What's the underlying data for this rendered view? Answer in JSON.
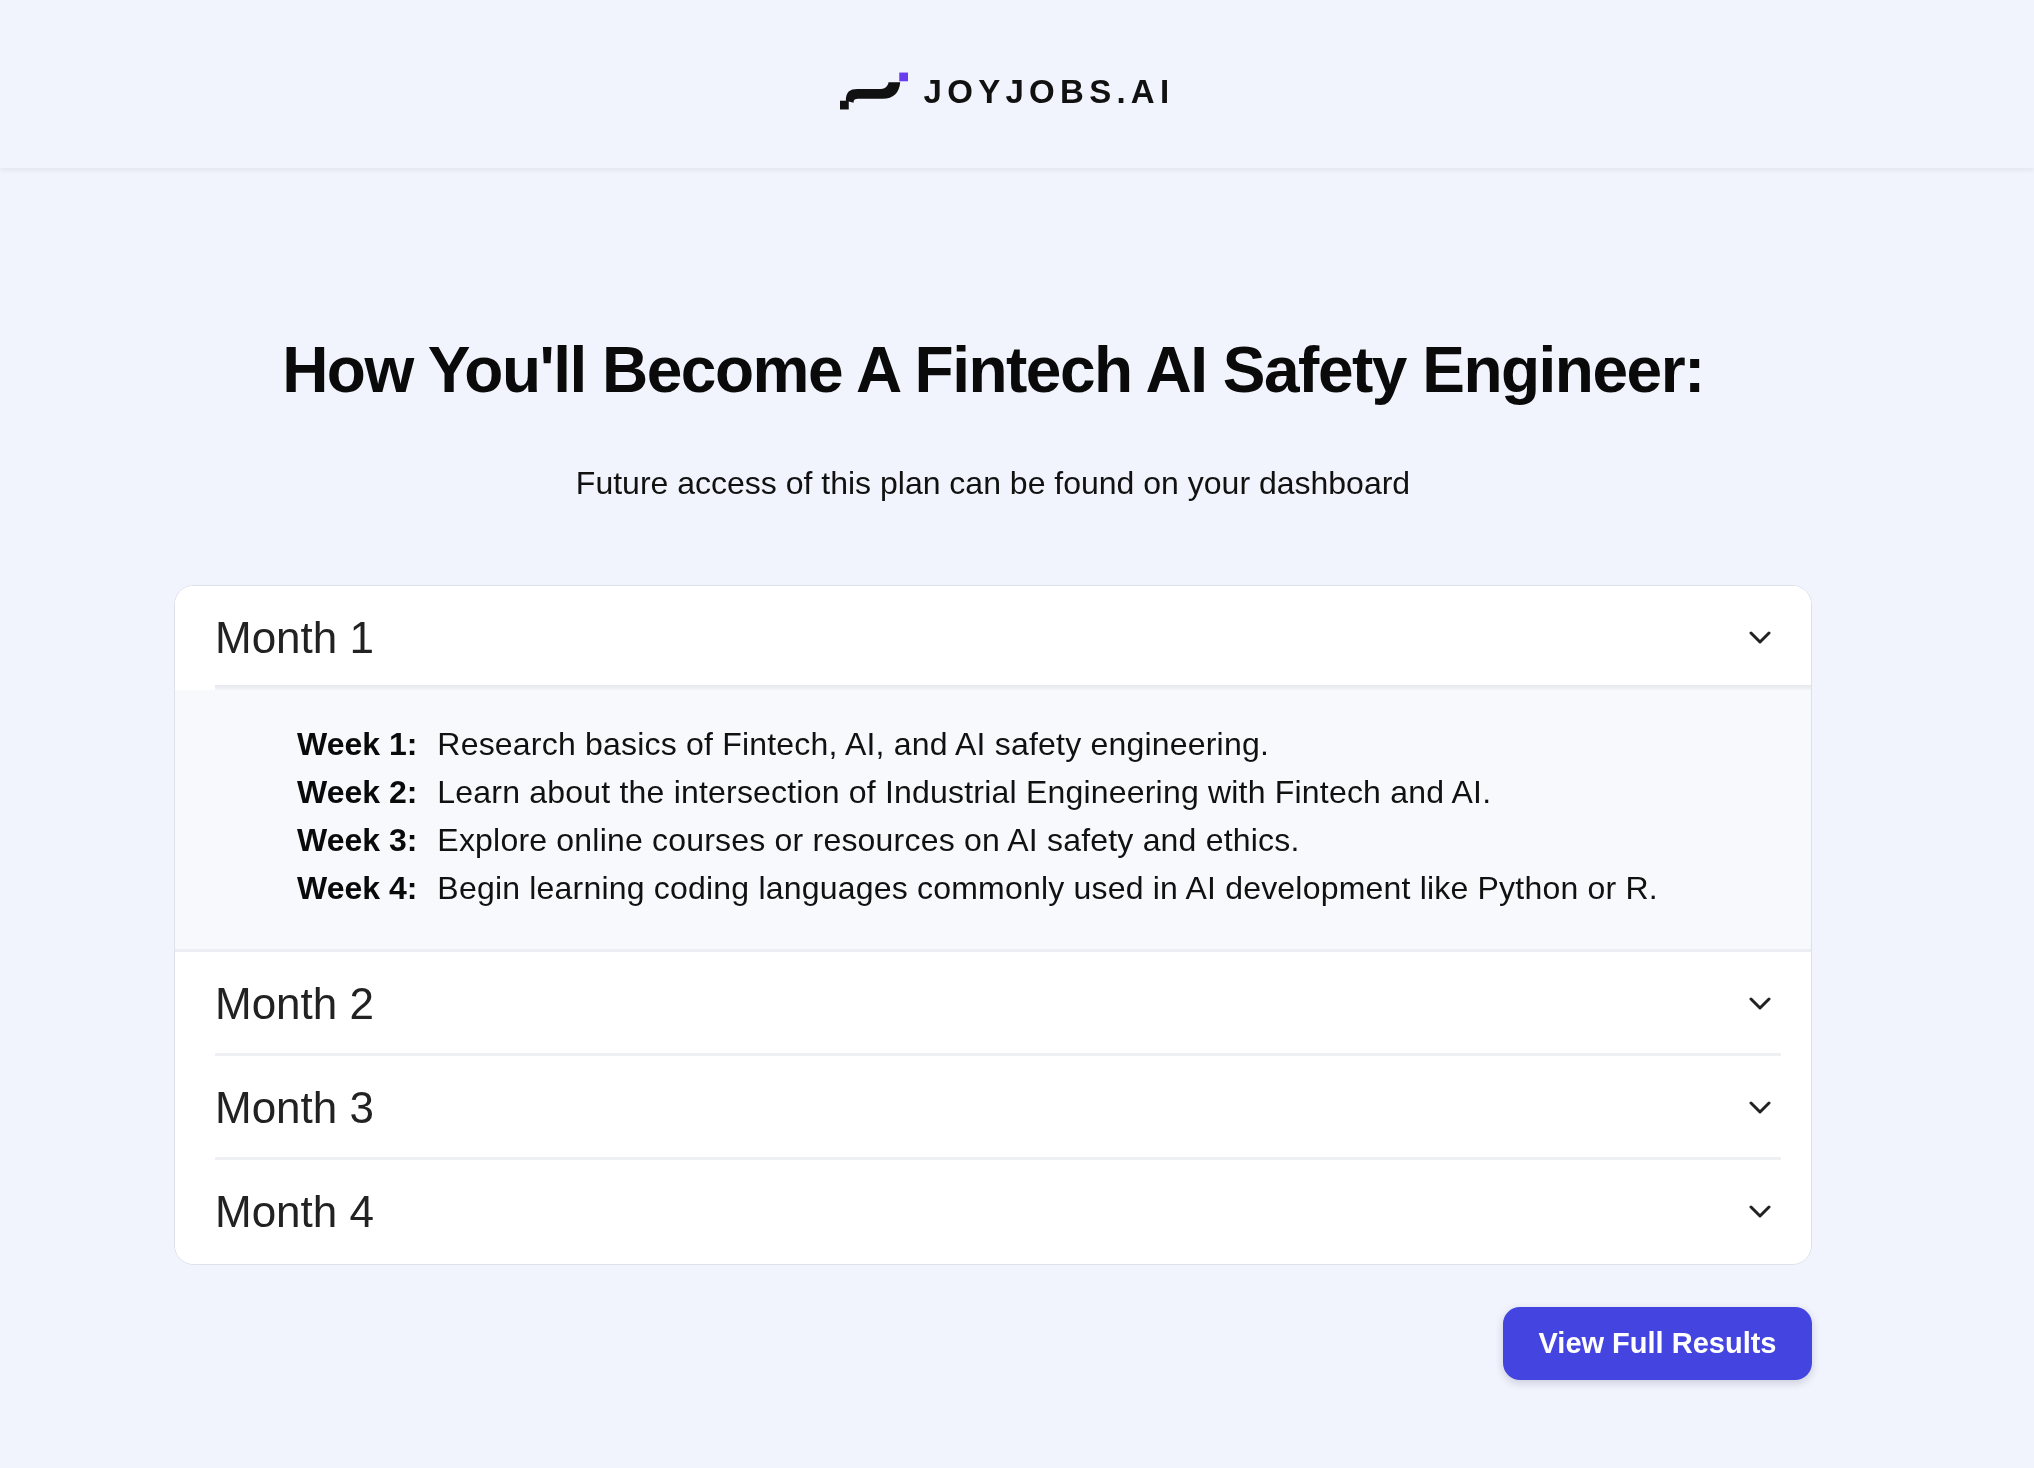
{
  "header": {
    "logo_text": "JOYJOBS.AI"
  },
  "title": "How You'll Become A Fintech AI Safety Engineer:",
  "subtitle": "Future access of this plan can be found on your dashboard",
  "accordion": [
    {
      "label": "Month 1",
      "expanded": true,
      "weeks": [
        {
          "label": "Week 1:",
          "text": "Research basics of Fintech, AI, and AI safety engineering."
        },
        {
          "label": "Week 2:",
          "text": "Learn about the intersection of Industrial Engineering with Fintech and AI."
        },
        {
          "label": "Week 3:",
          "text": "Explore online courses or resources on AI safety and ethics."
        },
        {
          "label": "Week 4:",
          "text": "Begin learning coding languages commonly used in AI development like Python or R."
        }
      ]
    },
    {
      "label": "Month 2",
      "expanded": false
    },
    {
      "label": "Month 3",
      "expanded": false
    },
    {
      "label": "Month 4",
      "expanded": false
    }
  ],
  "button": {
    "label": "View Full Results"
  }
}
